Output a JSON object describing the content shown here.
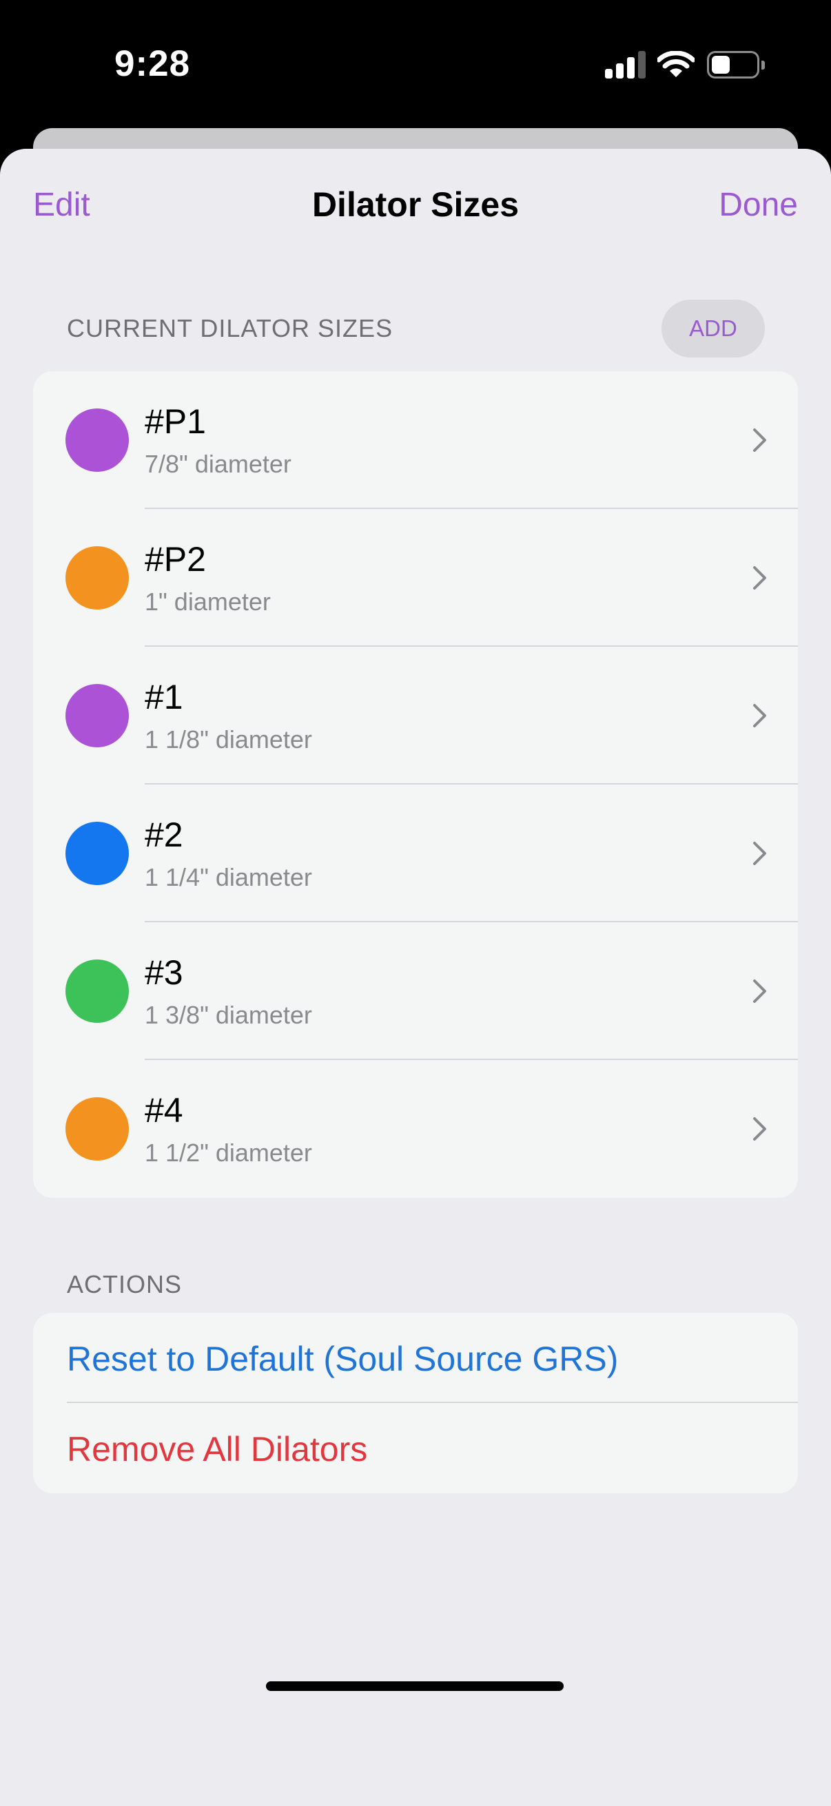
{
  "status_bar": {
    "time": "9:28",
    "icons": [
      "signal-icon",
      "wifi-icon",
      "battery-icon"
    ]
  },
  "nav": {
    "edit_label": "Edit",
    "title": "Dilator Sizes",
    "done_label": "Done"
  },
  "current_section": {
    "header": "CURRENT DILATOR SIZES",
    "add_label": "ADD",
    "items": [
      {
        "name": "#P1",
        "description": "7/8\" diameter",
        "color": "#AB52D6"
      },
      {
        "name": "#P2",
        "description": "1\" diameter",
        "color": "#F4921F"
      },
      {
        "name": "#1",
        "description": "1 1/8\" diameter",
        "color": "#AB52D6"
      },
      {
        "name": "#2",
        "description": "1 1/4\" diameter",
        "color": "#1577F0"
      },
      {
        "name": "#3",
        "description": "1 3/8\" diameter",
        "color": "#3DC259"
      },
      {
        "name": "#4",
        "description": "1 1/2\" diameter",
        "color": "#F4921F"
      }
    ]
  },
  "actions_section": {
    "header": "ACTIONS",
    "reset_label": "Reset to Default (Soul Source GRS)",
    "reset_color": "#1F74D6",
    "remove_label": "Remove All Dilators",
    "remove_color": "#E0383E"
  },
  "colors": {
    "accent": "#9A5AD0",
    "background": "#EBEBF0",
    "card": "#F4F5F5"
  }
}
